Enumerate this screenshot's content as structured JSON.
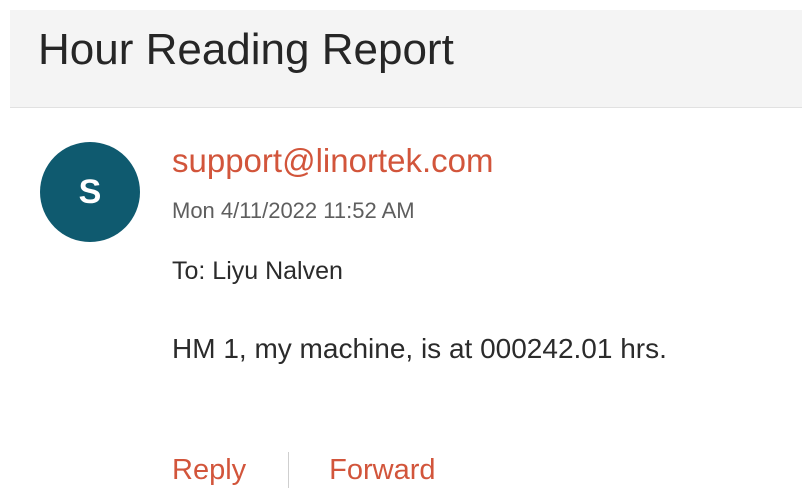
{
  "subject": "Hour Reading Report",
  "sender": {
    "avatar_initial": "S",
    "email": "support@linortek.com",
    "timestamp": "Mon 4/11/2022 11:52 AM"
  },
  "recipient_line": "To: Liyu Nalven",
  "body": "HM 1, my machine, is at 000242.01 hrs.",
  "actions": {
    "reply_label": "Reply",
    "forward_label": "Forward"
  },
  "colors": {
    "accent": "#d2553b",
    "avatar_bg": "#0f5a6f",
    "header_bg": "#f4f4f4"
  }
}
